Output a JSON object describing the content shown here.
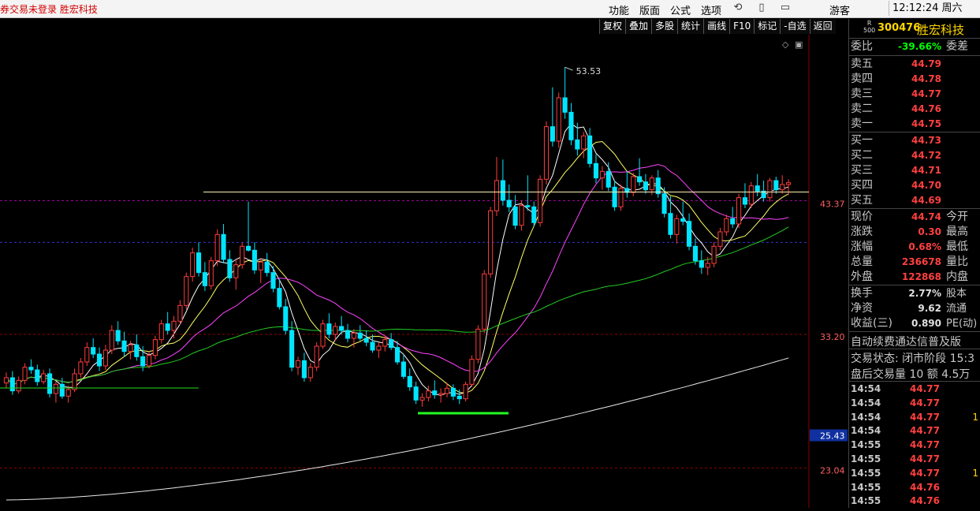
{
  "topbar": {
    "warning": "券交易未登录  胜宏科技",
    "menu": [
      "功能",
      "版面",
      "公式",
      "选项"
    ],
    "icons": [
      "refresh-icon",
      "phone-icon",
      "window-icon"
    ],
    "guest": "游客",
    "clock": "12:12:24 周六"
  },
  "toolbar": [
    "复权",
    "叠加",
    "多股",
    "统计",
    "画线",
    "F10",
    "标记",
    "-自选",
    "返回"
  ],
  "chart": {
    "peak_label": "53.53",
    "axis_labels": [
      "43.37",
      "33.20",
      "25.43",
      "23.04"
    ],
    "price_min": 20.0,
    "price_max": 56.0,
    "candles": [
      [
        29.5,
        30.3,
        29.1,
        29.9
      ],
      [
        29.9,
        30.4,
        28.6,
        28.9
      ],
      [
        28.9,
        30.0,
        28.7,
        29.7
      ],
      [
        29.7,
        31.0,
        29.4,
        30.7
      ],
      [
        30.7,
        31.3,
        30.2,
        30.5
      ],
      [
        30.5,
        30.9,
        29.3,
        29.6
      ],
      [
        29.6,
        30.5,
        29.4,
        30.2
      ],
      [
        30.2,
        30.6,
        28.4,
        28.7
      ],
      [
        28.7,
        29.6,
        28.0,
        29.4
      ],
      [
        29.4,
        29.9,
        28.3,
        28.5
      ],
      [
        28.5,
        29.3,
        28.0,
        29.0
      ],
      [
        29.0,
        30.6,
        28.8,
        30.2
      ],
      [
        30.2,
        31.4,
        29.9,
        31.1
      ],
      [
        31.1,
        32.6,
        30.8,
        32.2
      ],
      [
        32.2,
        32.9,
        31.4,
        31.7
      ],
      [
        31.7,
        32.2,
        30.4,
        30.8
      ],
      [
        30.8,
        32.4,
        30.5,
        32.0
      ],
      [
        32.0,
        33.9,
        31.7,
        33.5
      ],
      [
        33.5,
        34.2,
        32.4,
        32.7
      ],
      [
        32.7,
        33.4,
        31.5,
        31.9
      ],
      [
        31.9,
        32.7,
        31.3,
        32.4
      ],
      [
        32.4,
        33.2,
        31.2,
        31.5
      ],
      [
        31.5,
        32.3,
        30.4,
        30.8
      ],
      [
        30.8,
        31.9,
        30.6,
        31.6
      ],
      [
        31.6,
        33.1,
        31.3,
        32.8
      ],
      [
        32.8,
        34.3,
        32.5,
        34.0
      ],
      [
        34.0,
        34.9,
        33.2,
        33.5
      ],
      [
        33.5,
        34.6,
        32.9,
        34.2
      ],
      [
        34.2,
        35.8,
        33.9,
        35.4
      ],
      [
        35.4,
        37.9,
        35.1,
        37.6
      ],
      [
        37.6,
        39.8,
        37.2,
        39.4
      ],
      [
        39.4,
        40.2,
        37.6,
        37.9
      ],
      [
        37.9,
        38.7,
        36.5,
        36.9
      ],
      [
        36.9,
        39.1,
        36.6,
        38.8
      ],
      [
        38.8,
        41.2,
        38.4,
        40.8
      ],
      [
        40.8,
        41.6,
        38.6,
        38.9
      ],
      [
        38.9,
        39.6,
        37.2,
        37.5
      ],
      [
        37.5,
        38.9,
        36.6,
        38.5
      ],
      [
        38.5,
        40.2,
        38.2,
        39.9
      ],
      [
        39.9,
        43.3,
        39.5,
        39.6
      ],
      [
        39.6,
        40.2,
        37.8,
        38.1
      ],
      [
        38.1,
        39.0,
        37.1,
        38.7
      ],
      [
        38.7,
        39.4,
        37.6,
        37.9
      ],
      [
        37.9,
        38.4,
        36.4,
        36.7
      ],
      [
        36.7,
        37.4,
        35.1,
        35.3
      ],
      [
        35.3,
        35.9,
        33.2,
        33.5
      ],
      [
        33.5,
        34.2,
        30.4,
        30.7
      ],
      [
        30.7,
        31.5,
        30.1,
        31.2
      ],
      [
        31.2,
        31.8,
        29.6,
        29.9
      ],
      [
        29.9,
        31.0,
        29.6,
        30.7
      ],
      [
        30.7,
        32.6,
        30.4,
        32.3
      ],
      [
        32.3,
        34.3,
        32.1,
        34.0
      ],
      [
        34.0,
        34.8,
        32.9,
        33.2
      ],
      [
        33.2,
        34.1,
        32.7,
        33.8
      ],
      [
        33.8,
        34.6,
        33.2,
        33.5
      ],
      [
        33.5,
        34.0,
        32.6,
        32.9
      ],
      [
        32.9,
        33.6,
        32.2,
        33.3
      ],
      [
        33.3,
        33.9,
        32.7,
        32.9
      ],
      [
        32.9,
        33.5,
        32.3,
        32.6
      ],
      [
        32.6,
        33.2,
        31.8,
        32.0
      ],
      [
        32.0,
        32.6,
        31.4,
        32.3
      ],
      [
        32.3,
        33.1,
        31.9,
        32.8
      ],
      [
        32.8,
        33.3,
        32.0,
        32.2
      ],
      [
        32.2,
        32.7,
        30.9,
        31.1
      ],
      [
        31.1,
        31.7,
        29.8,
        30.0
      ],
      [
        30.0,
        30.6,
        28.9,
        29.2
      ],
      [
        29.2,
        29.6,
        27.9,
        28.2
      ],
      [
        28.2,
        28.7,
        27.7,
        28.4
      ],
      [
        28.4,
        29.3,
        28.1,
        28.9
      ],
      [
        28.9,
        29.7,
        28.3,
        28.6
      ],
      [
        28.6,
        29.1,
        28.0,
        28.7
      ],
      [
        28.7,
        29.5,
        28.4,
        29.1
      ],
      [
        29.1,
        29.4,
        28.2,
        28.5
      ],
      [
        28.5,
        29.0,
        27.9,
        28.3
      ],
      [
        28.3,
        29.6,
        28.1,
        29.4
      ],
      [
        29.4,
        31.6,
        29.2,
        31.3
      ],
      [
        31.3,
        33.9,
        31.0,
        33.6
      ],
      [
        33.6,
        38.1,
        33.3,
        37.8
      ],
      [
        37.8,
        42.9,
        37.5,
        42.6
      ],
      [
        42.6,
        46.7,
        42.2,
        44.9
      ],
      [
        44.9,
        46.5,
        43.0,
        43.4
      ],
      [
        43.4,
        44.6,
        42.5,
        42.9
      ],
      [
        42.9,
        43.8,
        41.2,
        41.5
      ],
      [
        41.5,
        43.4,
        41.1,
        43.0
      ],
      [
        43.0,
        45.3,
        42.6,
        42.9
      ],
      [
        42.9,
        43.3,
        41.4,
        41.7
      ],
      [
        41.7,
        45.3,
        41.4,
        45.0
      ],
      [
        45.0,
        49.4,
        44.6,
        49.0
      ],
      [
        49.0,
        52.0,
        47.5,
        47.9
      ],
      [
        47.9,
        51.6,
        47.4,
        51.2
      ],
      [
        51.2,
        53.53,
        49.6,
        50.1
      ],
      [
        50.1,
        50.8,
        47.6,
        48.0
      ],
      [
        48.0,
        49.3,
        46.8,
        47.3
      ],
      [
        47.3,
        48.6,
        46.6,
        48.3
      ],
      [
        48.3,
        48.9,
        45.9,
        46.2
      ],
      [
        46.2,
        46.9,
        44.7,
        45.1
      ],
      [
        45.1,
        46.0,
        44.2,
        45.6
      ],
      [
        45.6,
        46.3,
        44.1,
        44.4
      ],
      [
        44.4,
        44.9,
        42.6,
        42.9
      ],
      [
        42.9,
        44.6,
        42.6,
        44.3
      ],
      [
        44.3,
        45.6,
        43.6,
        44.0
      ],
      [
        44.0,
        45.5,
        43.7,
        45.2
      ],
      [
        45.2,
        46.6,
        44.5,
        44.8
      ],
      [
        44.8,
        45.4,
        43.9,
        44.2
      ],
      [
        44.2,
        45.3,
        43.8,
        45.1
      ],
      [
        45.1,
        45.7,
        43.6,
        43.9
      ],
      [
        43.9,
        44.4,
        42.1,
        42.4
      ],
      [
        42.4,
        43.7,
        40.5,
        40.8
      ],
      [
        40.8,
        42.3,
        40.1,
        42.0
      ],
      [
        42.0,
        43.3,
        41.5,
        41.8
      ],
      [
        41.8,
        42.4,
        39.6,
        39.9
      ],
      [
        39.9,
        40.5,
        38.5,
        38.8
      ],
      [
        38.8,
        39.6,
        37.8,
        38.3
      ],
      [
        38.3,
        39.1,
        37.7,
        38.6
      ],
      [
        38.6,
        40.2,
        38.3,
        39.9
      ],
      [
        39.9,
        41.3,
        39.6,
        41.0
      ],
      [
        41.0,
        42.3,
        40.7,
        42.0
      ],
      [
        42.0,
        42.9,
        41.3,
        41.6
      ],
      [
        41.6,
        43.9,
        41.3,
        43.6
      ],
      [
        43.6,
        44.7,
        42.8,
        43.1
      ],
      [
        43.1,
        44.8,
        42.8,
        44.5
      ],
      [
        44.5,
        45.4,
        43.7,
        44.1
      ],
      [
        44.1,
        44.9,
        43.3,
        43.6
      ],
      [
        43.6,
        45.1,
        43.3,
        44.9
      ],
      [
        44.9,
        45.2,
        43.9,
        44.2
      ],
      [
        44.2,
        45.3,
        43.9,
        44.6
      ],
      [
        44.6,
        45.0,
        43.8,
        44.74
      ]
    ]
  },
  "rpanel": {
    "r500": "R\n500",
    "code": "300476",
    "name": "胜宏科技",
    "ratio_label": "委比",
    "ratio_value": "-39.66%",
    "ratio_right": "委差",
    "asks": [
      {
        "label": "卖五",
        "value": "44.79"
      },
      {
        "label": "卖四",
        "value": "44.78"
      },
      {
        "label": "卖三",
        "value": "44.77"
      },
      {
        "label": "卖二",
        "value": "44.76"
      },
      {
        "label": "卖一",
        "value": "44.75"
      }
    ],
    "bids": [
      {
        "label": "买一",
        "value": "44.73"
      },
      {
        "label": "买二",
        "value": "44.72"
      },
      {
        "label": "买三",
        "value": "44.71"
      },
      {
        "label": "买四",
        "value": "44.70"
      },
      {
        "label": "买五",
        "value": "44.69"
      }
    ],
    "stats": [
      {
        "label": "现价",
        "value": "44.74",
        "right": "今开"
      },
      {
        "label": "涨跌",
        "value": "0.30",
        "right": "最高"
      },
      {
        "label": "涨幅",
        "value": "0.68%",
        "right": "最低"
      },
      {
        "label": "总量",
        "value": "236678",
        "right": "量比"
      },
      {
        "label": "外盘",
        "value": "122868",
        "right": "内盘"
      }
    ],
    "stats2": [
      {
        "label": "换手",
        "value": "2.77%",
        "right": "股本"
      },
      {
        "label": "净资",
        "value": "9.62",
        "right": "流通"
      },
      {
        "label": "收益(三)",
        "value": "0.890",
        "right": "PE(动)"
      }
    ],
    "notice": "自动续费通达信普及版",
    "status": "交易状态: 闭市阶段 15:3",
    "after": "盘后交易量 10 额 4.5万",
    "trades": [
      {
        "time": "14:54",
        "price": "44.77",
        "vol": ""
      },
      {
        "time": "14:54",
        "price": "44.77",
        "vol": ""
      },
      {
        "time": "14:54",
        "price": "44.77",
        "vol": "1"
      },
      {
        "time": "14:54",
        "price": "44.77",
        "vol": ""
      },
      {
        "time": "14:55",
        "price": "44.77",
        "vol": ""
      },
      {
        "time": "14:55",
        "price": "44.77",
        "vol": ""
      },
      {
        "time": "14:55",
        "price": "44.77",
        "vol": "1"
      },
      {
        "time": "14:55",
        "price": "44.76",
        "vol": ""
      },
      {
        "time": "14:55",
        "price": "44.76",
        "vol": ""
      }
    ]
  }
}
